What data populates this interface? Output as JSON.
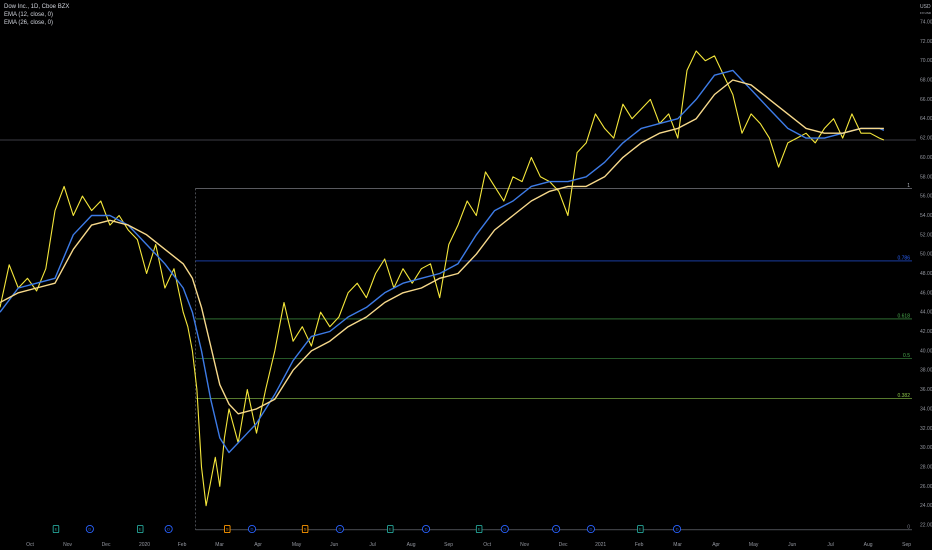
{
  "legend": {
    "title": "Dow Inc., 1D, Cboe BZX",
    "ema1": "EMA (12, close, 0)",
    "ema2": "EMA (26, close, 0)"
  },
  "axis": {
    "currency": "USD",
    "currency_sub": "FX:USD"
  },
  "colors": {
    "background": "#000000",
    "price": "#f5e73b",
    "ema12": "#3d7be6",
    "ema26": "#f7d98b",
    "axis_text": "#9598a1",
    "horizontal_line": "#787b86"
  },
  "chart_data": {
    "type": "line",
    "title": "Dow Inc., 1D, Cboe BZX",
    "xlabel": "",
    "ylabel": "",
    "y_scale": "linear",
    "ylim": [
      22,
      74
    ],
    "x_tick_labels": [
      "Oct",
      "Nov",
      "Dec",
      "2020",
      "Feb",
      "Mar",
      "Apr",
      "May",
      "Jun",
      "Jul",
      "Aug",
      "Sep",
      "Oct",
      "Nov",
      "Dec",
      "2021",
      "Feb",
      "Mar",
      "Apr",
      "May",
      "Jun",
      "Jul",
      "Aug",
      "Sep"
    ],
    "x_tick_fraction": [
      0.0,
      0.041,
      0.083,
      0.125,
      0.166,
      0.207,
      0.249,
      0.291,
      0.332,
      0.374,
      0.416,
      0.457,
      0.499,
      0.54,
      0.582,
      0.623,
      0.665,
      0.707,
      0.749,
      0.79,
      0.832,
      0.874,
      0.915,
      0.957
    ],
    "y_tick_labels": [
      "74.00",
      "72.00",
      "70.00",
      "68.00",
      "66.00",
      "64.00",
      "62.00",
      "60.00",
      "58.00",
      "56.00",
      "54.00",
      "52.00",
      "50.00",
      "48.00",
      "46.00",
      "44.00",
      "42.00",
      "40.00",
      "38.00",
      "36.00",
      "34.00",
      "32.00",
      "30.00",
      "28.00",
      "26.00",
      "24.00",
      "22.00"
    ],
    "horizontal_line": {
      "value": 61.8
    },
    "fibonacci": {
      "start_month_fraction": 0.207,
      "levels": [
        {
          "label": "1",
          "value": 56.8,
          "color": "#b2b5be"
        },
        {
          "label": "0.786",
          "value": 49.3,
          "color": "#2962ff"
        },
        {
          "label": "0.618",
          "value": 43.3,
          "color": "#4caf50"
        },
        {
          "label": "0.5",
          "value": 39.2,
          "color": "#4caf50"
        },
        {
          "label": "0.382",
          "value": 35.1,
          "color": "#8bc34a"
        },
        {
          "label": "0",
          "value": 21.5,
          "color": "#787b86"
        }
      ]
    },
    "series": [
      {
        "name": "Dow Inc., 1D, Cboe BZX",
        "color": "#f5e73b",
        "x": [
          0.0,
          0.01,
          0.02,
          0.03,
          0.04,
          0.05,
          0.06,
          0.07,
          0.08,
          0.09,
          0.1,
          0.11,
          0.12,
          0.13,
          0.14,
          0.15,
          0.16,
          0.17,
          0.18,
          0.19,
          0.2,
          0.205,
          0.21,
          0.215,
          0.22,
          0.225,
          0.23,
          0.235,
          0.24,
          0.245,
          0.25,
          0.26,
          0.27,
          0.28,
          0.29,
          0.3,
          0.31,
          0.32,
          0.33,
          0.34,
          0.35,
          0.36,
          0.37,
          0.38,
          0.39,
          0.4,
          0.41,
          0.42,
          0.43,
          0.44,
          0.45,
          0.46,
          0.47,
          0.48,
          0.49,
          0.5,
          0.51,
          0.52,
          0.53,
          0.54,
          0.55,
          0.56,
          0.57,
          0.58,
          0.59,
          0.6,
          0.61,
          0.62,
          0.63,
          0.64,
          0.65,
          0.66,
          0.67,
          0.68,
          0.69,
          0.7,
          0.71,
          0.72,
          0.73,
          0.74,
          0.75,
          0.76,
          0.77,
          0.78,
          0.79,
          0.8,
          0.81,
          0.82,
          0.83,
          0.84,
          0.85,
          0.86,
          0.87,
          0.88,
          0.89,
          0.9,
          0.91,
          0.92,
          0.93,
          0.94,
          0.95,
          0.96,
          0.965
        ],
        "values": [
          44.5,
          48.9,
          46.5,
          47.5,
          46.2,
          48.5,
          54.5,
          57.0,
          54.0,
          56.0,
          54.5,
          55.5,
          53.0,
          54.0,
          52.5,
          51.5,
          48.0,
          51.0,
          46.5,
          48.5,
          44.0,
          42.5,
          40.0,
          36.0,
          28.0,
          24.0,
          26.5,
          29.0,
          26.0,
          31.0,
          34.0,
          30.5,
          36.0,
          31.5,
          36.0,
          40.0,
          45.0,
          41.0,
          42.5,
          40.5,
          44.0,
          42.5,
          43.5,
          46.0,
          47.0,
          45.5,
          48.0,
          49.5,
          46.5,
          48.5,
          47.0,
          48.5,
          49.0,
          45.5,
          51.0,
          53.0,
          55.5,
          54.0,
          58.5,
          57.0,
          55.5,
          58.0,
          57.5,
          60.0,
          58.0,
          57.5,
          56.5,
          54.0,
          60.5,
          61.5,
          64.5,
          63.0,
          62.0,
          65.5,
          64.0,
          65.0,
          66.0,
          63.5,
          64.5,
          62.0,
          69.0,
          71.0,
          70.0,
          70.5,
          68.5,
          66.5,
          62.5,
          64.5,
          63.5,
          62.0,
          59.0,
          61.5,
          62.0,
          62.5,
          61.5,
          63.0,
          64.0,
          62.0,
          64.5,
          62.5,
          62.5,
          62.0,
          61.8
        ]
      },
      {
        "name": "EMA (12, close, 0)",
        "color": "#3d7be6",
        "x": [
          0.0,
          0.02,
          0.04,
          0.06,
          0.08,
          0.1,
          0.12,
          0.14,
          0.16,
          0.18,
          0.2,
          0.21,
          0.22,
          0.23,
          0.24,
          0.25,
          0.26,
          0.28,
          0.3,
          0.32,
          0.34,
          0.36,
          0.38,
          0.4,
          0.42,
          0.44,
          0.46,
          0.48,
          0.5,
          0.52,
          0.54,
          0.56,
          0.58,
          0.6,
          0.62,
          0.64,
          0.66,
          0.68,
          0.7,
          0.72,
          0.74,
          0.76,
          0.78,
          0.8,
          0.82,
          0.84,
          0.86,
          0.88,
          0.9,
          0.92,
          0.94,
          0.96,
          0.965
        ],
        "values": [
          44.0,
          46.5,
          47.0,
          47.5,
          52.0,
          54.0,
          54.0,
          53.0,
          51.0,
          49.0,
          46.5,
          44.0,
          40.0,
          35.0,
          31.0,
          29.5,
          30.5,
          32.5,
          35.5,
          39.0,
          41.5,
          42.0,
          43.5,
          44.5,
          46.0,
          47.0,
          47.5,
          48.0,
          49.0,
          52.0,
          54.5,
          55.5,
          57.0,
          57.5,
          57.5,
          58.0,
          59.5,
          61.5,
          63.0,
          63.5,
          64.0,
          66.0,
          68.5,
          69.0,
          67.0,
          65.0,
          63.0,
          62.0,
          62.0,
          62.5,
          63.0,
          63.0,
          62.8
        ]
      },
      {
        "name": "EMA (26, close, 0)",
        "color": "#f7d98b",
        "x": [
          0.0,
          0.02,
          0.04,
          0.06,
          0.08,
          0.1,
          0.12,
          0.14,
          0.16,
          0.18,
          0.2,
          0.21,
          0.22,
          0.23,
          0.24,
          0.25,
          0.26,
          0.28,
          0.3,
          0.32,
          0.34,
          0.36,
          0.38,
          0.4,
          0.42,
          0.44,
          0.46,
          0.48,
          0.5,
          0.52,
          0.54,
          0.56,
          0.58,
          0.6,
          0.62,
          0.64,
          0.66,
          0.68,
          0.7,
          0.72,
          0.74,
          0.76,
          0.78,
          0.8,
          0.82,
          0.84,
          0.86,
          0.88,
          0.9,
          0.92,
          0.94,
          0.96,
          0.965
        ],
        "values": [
          45.0,
          46.0,
          46.5,
          47.0,
          50.5,
          53.0,
          53.5,
          53.0,
          52.0,
          50.5,
          49.0,
          47.5,
          44.5,
          40.5,
          36.5,
          34.5,
          33.5,
          34.0,
          35.0,
          38.0,
          40.0,
          41.0,
          42.5,
          43.5,
          45.0,
          46.0,
          46.5,
          47.5,
          48.0,
          50.0,
          52.5,
          54.0,
          55.5,
          56.5,
          57.0,
          57.0,
          58.0,
          60.0,
          61.5,
          62.5,
          63.0,
          64.0,
          66.5,
          68.0,
          67.5,
          66.0,
          64.5,
          63.0,
          62.5,
          62.5,
          63.0,
          63.0,
          63.0
        ]
      }
    ],
    "event_badges": [
      {
        "x": 0.048,
        "kind": "earnings",
        "letter": "E",
        "color": "#26a69a"
      },
      {
        "x": 0.085,
        "kind": "dividend",
        "letter": "D",
        "color": "#2962ff"
      },
      {
        "x": 0.14,
        "kind": "earnings",
        "letter": "E",
        "color": "#26a69a"
      },
      {
        "x": 0.171,
        "kind": "dividend",
        "letter": "D",
        "color": "#2962ff"
      },
      {
        "x": 0.235,
        "kind": "split",
        "letter": "S",
        "color": "#ff9800"
      },
      {
        "x": 0.262,
        "kind": "dividend",
        "letter": "D",
        "color": "#2962ff"
      },
      {
        "x": 0.32,
        "kind": "split",
        "letter": "S",
        "color": "#ff9800"
      },
      {
        "x": 0.358,
        "kind": "dividend",
        "letter": "D",
        "color": "#2962ff"
      },
      {
        "x": 0.413,
        "kind": "earnings",
        "letter": "E",
        "color": "#26a69a"
      },
      {
        "x": 0.452,
        "kind": "dividend",
        "letter": "D",
        "color": "#2962ff"
      },
      {
        "x": 0.51,
        "kind": "earnings",
        "letter": "E",
        "color": "#26a69a"
      },
      {
        "x": 0.538,
        "kind": "dividend",
        "letter": "D",
        "color": "#2962ff"
      },
      {
        "x": 0.594,
        "kind": "dividend",
        "letter": "D",
        "color": "#2962ff"
      },
      {
        "x": 0.632,
        "kind": "dividend",
        "letter": "D",
        "color": "#2962ff"
      },
      {
        "x": 0.686,
        "kind": "earnings",
        "letter": "E",
        "color": "#26a69a"
      },
      {
        "x": 0.726,
        "kind": "dividend",
        "letter": "D",
        "color": "#2962ff"
      }
    ]
  }
}
